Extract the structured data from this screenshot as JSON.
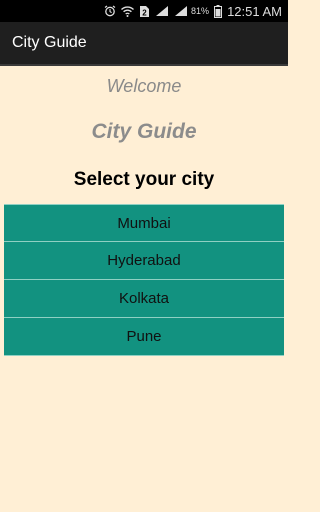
{
  "status_bar": {
    "sim_badge": "2",
    "battery_percent": "81%",
    "time": "12:51 AM",
    "icons": [
      "alarm-icon",
      "wifi-icon",
      "sim-icon",
      "signal-icon",
      "battery-icon"
    ]
  },
  "action_bar": {
    "title": "City Guide"
  },
  "main": {
    "welcome": "Welcome",
    "app_name": "City Guide",
    "prompt": "Select your city",
    "cities": [
      "Mumbai",
      "Hyderabad",
      "Kolkata",
      "Pune"
    ]
  },
  "colors": {
    "background": "#ffefd5",
    "list_item": "#129280",
    "action_bar": "#1f1f1f"
  }
}
